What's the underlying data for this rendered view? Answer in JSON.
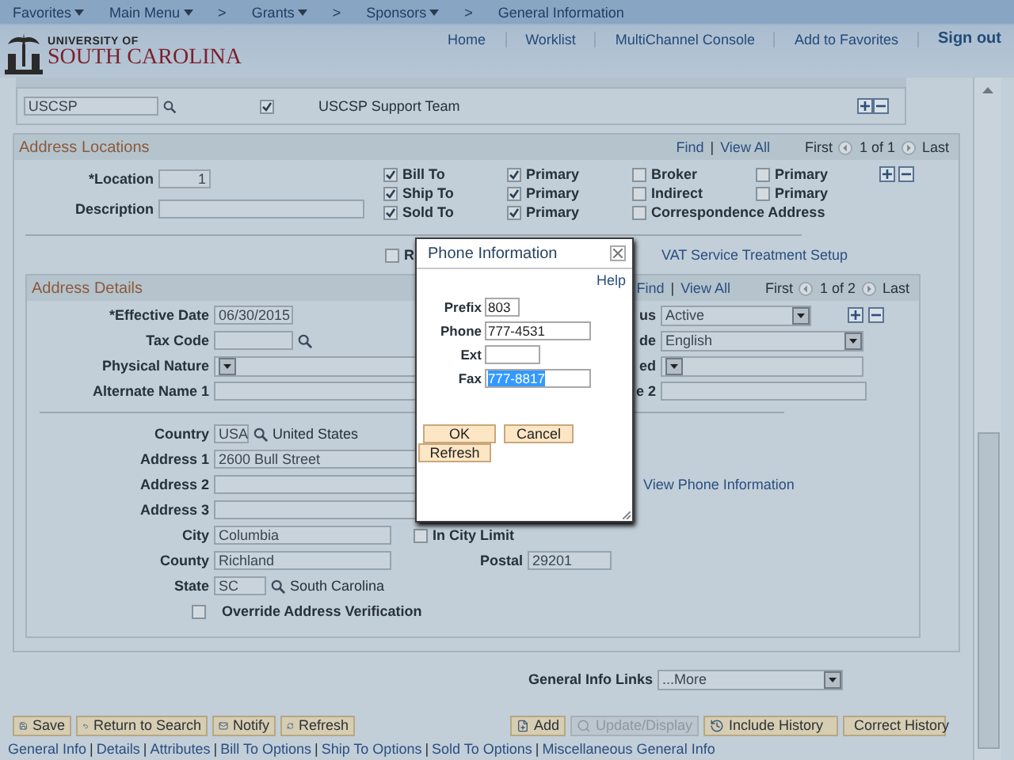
{
  "nav": {
    "items": [
      {
        "label": "Favorites",
        "dropdown": true
      },
      {
        "label": "Main Menu",
        "dropdown": true,
        "separator": ">"
      },
      {
        "label": "Grants",
        "dropdown": true,
        "separator": ">"
      },
      {
        "label": "Sponsors",
        "dropdown": true,
        "separator": ">"
      },
      {
        "label": "General Information",
        "dropdown": false
      }
    ]
  },
  "header": {
    "logo_top": "UNIVERSITY OF",
    "logo_bottom": "SOUTH CAROLINA",
    "links": [
      "Home",
      "Worklist",
      "MultiChannel Console",
      "Add to Favorites"
    ],
    "sign_out": "Sign out"
  },
  "code_row": {
    "code": "USCSP",
    "default_checked": true,
    "description": "USCSP Support Team"
  },
  "address_locations": {
    "title": "Address Locations",
    "find": "Find",
    "pipe": "|",
    "view_all": "View All",
    "first": "First",
    "count": "1 of 1",
    "last": "Last",
    "location_label": "*Location",
    "location": "1",
    "description_label": "Description",
    "flags": [
      {
        "label": "Bill To",
        "checked": true
      },
      {
        "label": "Primary",
        "checked": true
      },
      {
        "label": "Broker",
        "checked": false
      },
      {
        "label": "Primary",
        "checked": false
      },
      {
        "label": "Ship To",
        "checked": true
      },
      {
        "label": "Primary",
        "checked": true
      },
      {
        "label": "Indirect",
        "checked": false
      },
      {
        "label": "Primary",
        "checked": false
      },
      {
        "label": "Sold To",
        "checked": true
      },
      {
        "label": "Primary",
        "checked": true
      },
      {
        "label": "Correspondence Address",
        "checked": false
      }
    ],
    "partial_flag": {
      "label": "R",
      "checked": false
    },
    "vat_link": "VAT Service Treatment Setup"
  },
  "address_details": {
    "title": "Address Details",
    "find": "Find",
    "pipe": "|",
    "view_all": "View All",
    "first": "First",
    "count": "1 of 2",
    "last": "Last",
    "effective_date_label": "*Effective Date",
    "effective_date": "06/30/2015",
    "status_label": "us",
    "status": "Active",
    "tax_code_label": "Tax Code",
    "language_label": "de",
    "language": "English",
    "physical_nature_label": "Physical Nature",
    "field_3_label": "ed",
    "alt_name_1_label": "Alternate Name 1",
    "alt_name_2_label": "e 2",
    "country_label": "Country",
    "country": "USA",
    "country_name": "United States",
    "address1_label": "Address 1",
    "address1": "2600 Bull Street",
    "address2_label": "Address 2",
    "view_phone": "View Phone Information",
    "address3_label": "Address 3",
    "city_label": "City",
    "city": "Columbia",
    "in_city_limit": {
      "label": "In City Limit",
      "checked": false
    },
    "county_label": "County",
    "county": "Richland",
    "postal_label": "Postal",
    "postal": "29201",
    "state_label": "State",
    "state": "SC",
    "state_name": "South Carolina",
    "override": {
      "label": "Override Address Verification",
      "checked": false
    }
  },
  "general_info_links": {
    "label": "General Info Links",
    "value": "...More"
  },
  "toolbar": [
    {
      "label": "Save",
      "disabled": false
    },
    {
      "label": "Return to Search",
      "disabled": false
    },
    {
      "label": "Notify",
      "disabled": false
    },
    {
      "label": "Refresh",
      "disabled": false
    },
    {
      "label": "Add",
      "disabled": false
    },
    {
      "label": "Update/Display",
      "disabled": true
    },
    {
      "label": "Include History",
      "disabled": false
    },
    {
      "label": "Correct History",
      "disabled": false
    }
  ],
  "footer_links": [
    {
      "label": "General Info"
    },
    {
      "separator": "|",
      "label": "Details"
    },
    {
      "separator": "|",
      "label": "Attributes"
    },
    {
      "separator": "|",
      "label": "Bill To Options"
    },
    {
      "separator": "|",
      "label": "Ship To Options"
    },
    {
      "separator": "|",
      "label": "Sold To Options"
    },
    {
      "separator": "|",
      "label": "Miscellaneous General Info"
    }
  ],
  "dialog": {
    "title": "Phone Information",
    "help": "Help",
    "fields": [
      {
        "label": "Prefix",
        "value": "803",
        "highlighted": false
      },
      {
        "label": "Phone",
        "value": "777-4531",
        "highlighted": false
      },
      {
        "label": "Ext",
        "highlighted": false
      },
      {
        "label": "Fax",
        "value": "777-8817",
        "highlighted": true
      }
    ],
    "ok": "OK",
    "cancel": "Cancel",
    "refresh": "Refresh"
  }
}
